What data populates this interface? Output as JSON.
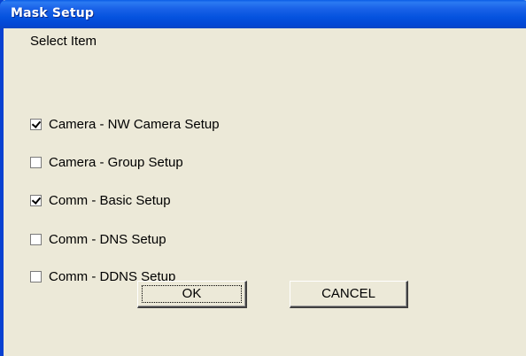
{
  "window": {
    "title": "Mask Setup"
  },
  "select_label": "Select Item",
  "items": [
    {
      "label": "Camera - NW Camera Setup",
      "checked": true
    },
    {
      "label": "Camera - Group Setup",
      "checked": false
    },
    {
      "label": "Comm - Basic Setup",
      "checked": true
    },
    {
      "label": "Comm - DNS Setup",
      "checked": false
    },
    {
      "label": "Comm - DDNS Setup",
      "checked": false
    }
  ],
  "buttons": {
    "ok": "OK",
    "cancel": "CANCEL"
  },
  "colors": {
    "titlebar": "#0553df",
    "background": "#ece9d8"
  }
}
